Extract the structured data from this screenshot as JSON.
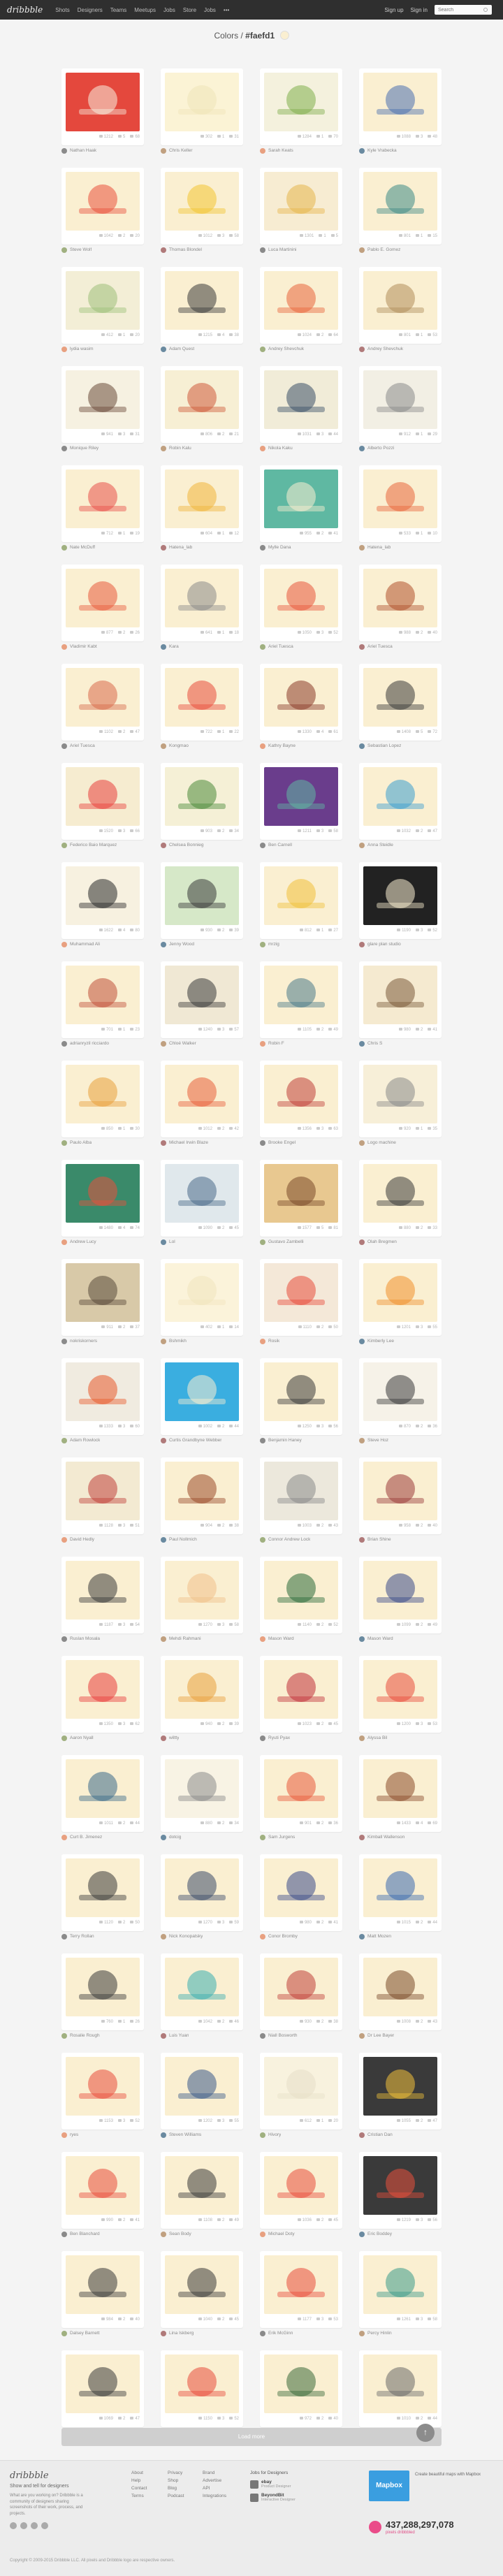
{
  "nav": {
    "logo": "dribbble",
    "items": [
      "Shots",
      "Designers",
      "Teams",
      "Meetups",
      "Jobs",
      "Store",
      "Jobs",
      "•••"
    ],
    "signup": "Sign up",
    "signin": "Sign in",
    "search_placeholder": "Search"
  },
  "page": {
    "prefix": "Colors /",
    "hex": "#faefd1",
    "swatch": "#faefd1"
  },
  "shots": [
    {
      "author": "Nathan Haak",
      "views": "1212",
      "comments": "5",
      "likes": "68",
      "bg": "#e4483d",
      "fg": "#f7f0e0"
    },
    {
      "author": "Chris Keller",
      "views": "302",
      "comments": "1",
      "likes": "31",
      "bg": "#fbf3d5",
      "fg": "#efe4b8"
    },
    {
      "author": "Sarah Keats",
      "views": "1284",
      "comments": "1",
      "likes": "70",
      "bg": "#f4f1dd",
      "fg": "#7fae4b"
    },
    {
      "author": "Kyle Vrabecka",
      "views": "1088",
      "comments": "3",
      "likes": "48",
      "bg": "#faefd1",
      "fg": "#4a6fb0"
    },
    {
      "author": "Steve Wolf",
      "views": "1042",
      "comments": "2",
      "likes": "20",
      "bg": "#faefd1",
      "fg": "#e9503c"
    },
    {
      "author": "Thomas Blondel",
      "views": "1012",
      "comments": "3",
      "likes": "58",
      "bg": "#faefd1",
      "fg": "#f2c531"
    },
    {
      "author": "Luca Martinini",
      "views": "1301",
      "comments": "1",
      "likes": "5",
      "bg": "#f7ecd2",
      "fg": "#e6b64b"
    },
    {
      "author": "Pablo E. Gomez",
      "views": "801",
      "comments": "1",
      "likes": "15",
      "bg": "#faefd1",
      "fg": "#3d8a86"
    },
    {
      "author": "lydia wasim",
      "views": "412",
      "comments": "1",
      "likes": "20",
      "bg": "#f3eed6",
      "fg": "#9dc07a"
    },
    {
      "author": "Adam Quest",
      "views": "1215",
      "comments": "4",
      "likes": "38",
      "bg": "#faefd1",
      "fg": "#3b3b3b"
    },
    {
      "author": "Andrey Shevchuk",
      "views": "1024",
      "comments": "2",
      "likes": "64",
      "bg": "#faefd1",
      "fg": "#e8653c"
    },
    {
      "author": "Andrey Shevchuk",
      "views": "801",
      "comments": "1",
      "likes": "53",
      "bg": "#faefd1",
      "fg": "#b08d5a"
    },
    {
      "author": "Monique Riley",
      "views": "941",
      "comments": "3",
      "likes": "31",
      "bg": "#f6f1e1",
      "fg": "#6a4a3a"
    },
    {
      "author": "Robin Kalu",
      "views": "806",
      "comments": "2",
      "likes": "21",
      "bg": "#f7efd4",
      "fg": "#cf5a3a"
    },
    {
      "author": "Nikola Kaku",
      "views": "1031",
      "comments": "3",
      "likes": "44",
      "bg": "#f1ecd8",
      "fg": "#3a5068"
    },
    {
      "author": "Alberto Pozzi",
      "views": "912",
      "comments": "1",
      "likes": "29",
      "bg": "#f2efe4",
      "fg": "#8a8a8a"
    },
    {
      "author": "Nate McDuff",
      "views": "712",
      "comments": "1",
      "likes": "19",
      "bg": "#faefd1",
      "fg": "#e8504a"
    },
    {
      "author": "Hatena_lab",
      "views": "604",
      "comments": "1",
      "likes": "12",
      "bg": "#faefd1",
      "fg": "#f0b43a"
    },
    {
      "author": "Mylle Dana",
      "views": "955",
      "comments": "2",
      "likes": "41",
      "bg": "#5fb8a2",
      "fg": "#faefd1"
    },
    {
      "author": "Hatena_lab",
      "views": "533",
      "comments": "1",
      "likes": "10",
      "bg": "#faefd1",
      "fg": "#e8663c"
    },
    {
      "author": "Vladimir Kabt",
      "views": "877",
      "comments": "2",
      "likes": "26",
      "bg": "#faefd1",
      "fg": "#e85a3c"
    },
    {
      "author": "Kara",
      "views": "641",
      "comments": "1",
      "likes": "18",
      "bg": "#faefd1",
      "fg": "#8a8a8a"
    },
    {
      "author": "Ariel Tuesca",
      "views": "1050",
      "comments": "3",
      "likes": "52",
      "bg": "#faefd1",
      "fg": "#e8563c"
    },
    {
      "author": "Ariel Tuesca",
      "views": "988",
      "comments": "2",
      "likes": "40",
      "bg": "#faefd1",
      "fg": "#b0502c"
    },
    {
      "author": "Ariel Tuesca",
      "views": "1102",
      "comments": "2",
      "likes": "47",
      "bg": "#faefd1",
      "fg": "#d86a4c"
    },
    {
      "author": "Kongmao",
      "views": "722",
      "comments": "1",
      "likes": "22",
      "bg": "#faefd1",
      "fg": "#e84c3c"
    },
    {
      "author": "Kathry Bayne",
      "views": "1330",
      "comments": "4",
      "likes": "61",
      "bg": "#faefd1",
      "fg": "#8a3a2a"
    },
    {
      "author": "Sebastian Lopez",
      "views": "1408",
      "comments": "5",
      "likes": "72",
      "bg": "#faefd1",
      "fg": "#3a3a3a"
    },
    {
      "author": "Federico Baio Marquez",
      "views": "1520",
      "comments": "3",
      "likes": "66",
      "bg": "#f6ecd0",
      "fg": "#e8403c"
    },
    {
      "author": "Chelsea Bonnieg",
      "views": "903",
      "comments": "2",
      "likes": "34",
      "bg": "#f5f0d6",
      "fg": "#4a8a3a"
    },
    {
      "author": "Ben Carnell",
      "views": "1211",
      "comments": "3",
      "likes": "58",
      "bg": "#6a3d8c",
      "fg": "#5fb8a2"
    },
    {
      "author": "Anna Steidle",
      "views": "1032",
      "comments": "2",
      "likes": "47",
      "bg": "#faefd1",
      "fg": "#3a9ed0"
    },
    {
      "author": "Muhammad Ali",
      "views": "1622",
      "comments": "4",
      "likes": "80",
      "bg": "#f7f1e0",
      "fg": "#2a2a2a"
    },
    {
      "author": "Jenny Wood",
      "views": "930",
      "comments": "2",
      "likes": "39",
      "bg": "#d6e8c8",
      "fg": "#3a3a3a"
    },
    {
      "author": "mrzig",
      "views": "812",
      "comments": "1",
      "likes": "27",
      "bg": "#faefd1",
      "fg": "#f0c03a"
    },
    {
      "author": "glare plan studio",
      "views": "1190",
      "comments": "3",
      "likes": "52",
      "bg": "#222222",
      "fg": "#faefd1"
    },
    {
      "author": "adrianryzil ricciardo",
      "views": "701",
      "comments": "1",
      "likes": "23",
      "bg": "#faefd1",
      "fg": "#c0503a"
    },
    {
      "author": "Chloé Walker",
      "views": "1240",
      "comments": "3",
      "likes": "57",
      "bg": "#f0e8d4",
      "fg": "#3a3a3a"
    },
    {
      "author": "Robin F",
      "views": "1105",
      "comments": "2",
      "likes": "49",
      "bg": "#faefd1",
      "fg": "#4a7a8a"
    },
    {
      "author": "Chris S",
      "views": "980",
      "comments": "2",
      "likes": "41",
      "bg": "#f5ead0",
      "fg": "#7a5a3a"
    },
    {
      "author": "Paulo Alba",
      "views": "850",
      "comments": "1",
      "likes": "30",
      "bg": "#faefd1",
      "fg": "#e8a03c"
    },
    {
      "author": "Michael Irwin Blaze",
      "views": "1012",
      "comments": "2",
      "likes": "42",
      "bg": "#faefd1",
      "fg": "#e8603c"
    },
    {
      "author": "Brooke Engel",
      "views": "1356",
      "comments": "3",
      "likes": "63",
      "bg": "#faefd1",
      "fg": "#c0403a"
    },
    {
      "author": "Logo machine",
      "views": "920",
      "comments": "1",
      "likes": "35",
      "bg": "#f7efd8",
      "fg": "#8a8a8a"
    },
    {
      "author": "Andrew Lucy",
      "views": "1480",
      "comments": "4",
      "likes": "74",
      "bg": "#3a8a6a",
      "fg": "#e8503c"
    },
    {
      "author": "Lol",
      "views": "1090",
      "comments": "2",
      "likes": "45",
      "bg": "#e0e8ec",
      "fg": "#4a6a8a"
    },
    {
      "author": "Gustavo Zambelli",
      "views": "1577",
      "comments": "5",
      "likes": "81",
      "bg": "#e8c890",
      "fg": "#7a4a2a"
    },
    {
      "author": "Olah Bregmen",
      "views": "880",
      "comments": "2",
      "likes": "33",
      "bg": "#faefd1",
      "fg": "#3a3a3a"
    },
    {
      "author": "nokriskorners",
      "views": "911",
      "comments": "2",
      "likes": "37",
      "bg": "#d8c9a8",
      "fg": "#5a4a3a"
    },
    {
      "author": "Bshmikh",
      "views": "402",
      "comments": "1",
      "likes": "14",
      "bg": "#fbf3da",
      "fg": "#f1e4bd"
    },
    {
      "author": "Rosik",
      "views": "1110",
      "comments": "2",
      "likes": "50",
      "bg": "#f4e8d8",
      "fg": "#e84c3c"
    },
    {
      "author": "Kimberly Lee",
      "views": "1201",
      "comments": "3",
      "likes": "55",
      "bg": "#faefd1",
      "fg": "#f0902c"
    },
    {
      "author": "Adam Rowlock",
      "views": "1333",
      "comments": "3",
      "likes": "60",
      "bg": "#f0ebe0",
      "fg": "#e85a2c"
    },
    {
      "author": "Curtis Grandbyne Webber",
      "views": "1002",
      "comments": "2",
      "likes": "44",
      "bg": "#3aaee0",
      "fg": "#faefd1"
    },
    {
      "author": "Benjamin Haney",
      "views": "1250",
      "comments": "3",
      "likes": "56",
      "bg": "#faefd1",
      "fg": "#3a3a3a"
    },
    {
      "author": "Steve Hoz",
      "views": "870",
      "comments": "2",
      "likes": "36",
      "bg": "#f6f2e8",
      "fg": "#3a3a3a"
    },
    {
      "author": "David Hedly",
      "views": "1128",
      "comments": "3",
      "likes": "51",
      "bg": "#f3ead2",
      "fg": "#c0403a"
    },
    {
      "author": "Paul Nollmich",
      "views": "904",
      "comments": "2",
      "likes": "38",
      "bg": "#faefd1",
      "fg": "#9a4a2a"
    },
    {
      "author": "Connor Andrew Lock",
      "views": "1003",
      "comments": "2",
      "likes": "43",
      "bg": "#ece8dc",
      "fg": "#8a8a8a"
    },
    {
      "author": "Brian Shine",
      "views": "958",
      "comments": "2",
      "likes": "40",
      "bg": "#faefd1",
      "fg": "#9a3a3a"
    },
    {
      "author": "Ruslan Mosala",
      "views": "1187",
      "comments": "3",
      "likes": "54",
      "bg": "#faefd1",
      "fg": "#3a3a3a"
    },
    {
      "author": "Mehdi Rahmani",
      "views": "1270",
      "comments": "3",
      "likes": "58",
      "bg": "#faefd1",
      "fg": "#f0c08a"
    },
    {
      "author": "Mason Ward",
      "views": "1140",
      "comments": "2",
      "likes": "52",
      "bg": "#faefd1",
      "fg": "#2a6a3a"
    },
    {
      "author": "Mason Ward",
      "views": "1099",
      "comments": "2",
      "likes": "49",
      "bg": "#faefd1",
      "fg": "#3a4a8a"
    },
    {
      "author": "Aaron Nyall",
      "views": "1350",
      "comments": "3",
      "likes": "62",
      "bg": "#faefd1",
      "fg": "#e83c3c"
    },
    {
      "author": "wiltty",
      "views": "940",
      "comments": "2",
      "likes": "39",
      "bg": "#faefd1",
      "fg": "#e8a03c"
    },
    {
      "author": "Ryuti Pyax",
      "views": "1023",
      "comments": "2",
      "likes": "45",
      "bg": "#faefd1",
      "fg": "#c0303a"
    },
    {
      "author": "Alyssa Bil",
      "views": "1200",
      "comments": "3",
      "likes": "53",
      "bg": "#faefd1",
      "fg": "#e84c3c"
    },
    {
      "author": "Curt B. Jimenez",
      "views": "1011",
      "comments": "2",
      "likes": "44",
      "bg": "#faefd1",
      "fg": "#3a6a8a"
    },
    {
      "author": "dotcig",
      "views": "880",
      "comments": "2",
      "likes": "34",
      "bg": "#f8f3e4",
      "fg": "#8a8a8a"
    },
    {
      "author": "Sam Jurgens",
      "views": "901",
      "comments": "2",
      "likes": "36",
      "bg": "#faefd1",
      "fg": "#e85a3c"
    },
    {
      "author": "Kimball Wallenson",
      "views": "1433",
      "comments": "4",
      "likes": "69",
      "bg": "#faefd1",
      "fg": "#8a4a2a"
    },
    {
      "author": "Terry Rollan",
      "views": "1120",
      "comments": "2",
      "likes": "50",
      "bg": "#faefd1",
      "fg": "#3a3a3a"
    },
    {
      "author": "Nick Konopatsky",
      "views": "1270",
      "comments": "3",
      "likes": "59",
      "bg": "#faefd1",
      "fg": "#3a4a6a"
    },
    {
      "author": "Conor Bromby",
      "views": "980",
      "comments": "2",
      "likes": "41",
      "bg": "#faefd1",
      "fg": "#3a4a8a"
    },
    {
      "author": "Matt Mozen",
      "views": "1015",
      "comments": "2",
      "likes": "44",
      "bg": "#faefd1",
      "fg": "#3a6ab0"
    },
    {
      "author": "Rosalie Rough",
      "views": "760",
      "comments": "1",
      "likes": "26",
      "bg": "#faefd1",
      "fg": "#3a3a3a"
    },
    {
      "author": "Luis Yuan",
      "views": "1042",
      "comments": "2",
      "likes": "46",
      "bg": "#faefd1",
      "fg": "#3aaeb0"
    },
    {
      "author": "Niall Bosworth",
      "views": "930",
      "comments": "2",
      "likes": "38",
      "bg": "#faefd1",
      "fg": "#c0403a"
    },
    {
      "author": "Dr Lee Bayer",
      "views": "1008",
      "comments": "2",
      "likes": "43",
      "bg": "#faefd1",
      "fg": "#7a4a2a"
    },
    {
      "author": "ryes",
      "views": "1153",
      "comments": "3",
      "likes": "52",
      "bg": "#faefd1",
      "fg": "#e84c3c"
    },
    {
      "author": "Steven Williams",
      "views": "1202",
      "comments": "3",
      "likes": "55",
      "bg": "#faefd1",
      "fg": "#3a5a8a"
    },
    {
      "author": "Hivory",
      "views": "612",
      "comments": "1",
      "likes": "20",
      "bg": "#f8f2de",
      "fg": "#e6dfc8"
    },
    {
      "author": "Cristian Dan",
      "views": "1055",
      "comments": "2",
      "likes": "47",
      "bg": "#3a3a3a",
      "fg": "#f0c03a"
    },
    {
      "author": "Ben Blanchard",
      "views": "990",
      "comments": "2",
      "likes": "41",
      "bg": "#faefd1",
      "fg": "#e84c3c"
    },
    {
      "author": "Sean Body",
      "views": "1108",
      "comments": "2",
      "likes": "49",
      "bg": "#faefd1",
      "fg": "#3a3a3a"
    },
    {
      "author": "Michael Doty",
      "views": "1036",
      "comments": "2",
      "likes": "45",
      "bg": "#faefd1",
      "fg": "#e84c3c"
    },
    {
      "author": "Eric Boddey",
      "views": "1219",
      "comments": "3",
      "likes": "56",
      "bg": "#3a3a3a",
      "fg": "#e8503c"
    },
    {
      "author": "Dalsey Barnett",
      "views": "984",
      "comments": "2",
      "likes": "40",
      "bg": "#faefd1",
      "fg": "#3a3a3a"
    },
    {
      "author": "Lina Iskberg",
      "views": "1040",
      "comments": "2",
      "likes": "45",
      "bg": "#faefd1",
      "fg": "#3a3a3a"
    },
    {
      "author": "Erik McGinn",
      "views": "1177",
      "comments": "3",
      "likes": "53",
      "bg": "#faefd1",
      "fg": "#e84c3c"
    },
    {
      "author": "Percy Hinlin",
      "views": "1261",
      "comments": "3",
      "likes": "58",
      "bg": "#faefd1",
      "fg": "#3a9a8a"
    },
    {
      "author": "Joe Fletcher",
      "views": "1069",
      "comments": "2",
      "likes": "47",
      "bg": "#faefd1",
      "fg": "#3a3a3a"
    },
    {
      "author": "Andrey Sotnikov",
      "views": "1150",
      "comments": "3",
      "likes": "52",
      "bg": "#faefd1",
      "fg": "#e84c3c"
    },
    {
      "author": "Patrick E. Gomez",
      "views": "972",
      "comments": "2",
      "likes": "40",
      "bg": "#faefd1",
      "fg": "#3a6a3a"
    },
    {
      "author": "Jae Caruthers",
      "views": "1010",
      "comments": "2",
      "likes": "44",
      "bg": "#faefd1",
      "fg": "#6a6a6a"
    }
  ],
  "load_more": "Load more",
  "to_top": "↑",
  "footer": {
    "logo": "dribbble",
    "tagline": "Show and tell for designers",
    "description": "What are you working on? Dribbble is a community of designers sharing screenshots of their work, process, and projects.",
    "col1": [
      "About",
      "Help",
      "Contact",
      "Terms"
    ],
    "col2": [
      "Privacy",
      "Shop",
      "Blog",
      "Podcast"
    ],
    "col3": [
      "Brand",
      "Advertise",
      "API",
      "Integrations"
    ],
    "designers_heading": "Jobs for Designers",
    "designers": [
      {
        "name": "ebay",
        "sub": "Product Designer"
      },
      {
        "name": "BeyondBit",
        "sub": "Interactive Designer"
      }
    ],
    "ad_brand": "Mapbox",
    "ad_text": "Create beautiful maps with Mapbox",
    "counter": "437,288,297,078",
    "counter_label": "pixels dribbbled",
    "copyright": "Copyright © 2009-2015 Dribbble LLC. All pixels and Dribbble logo are respective owners."
  }
}
